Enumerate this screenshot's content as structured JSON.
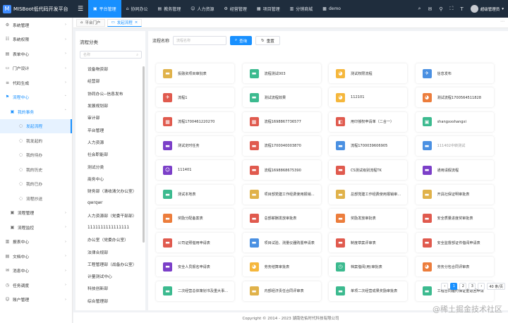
{
  "app": {
    "title": "MISBoot低代码开发平台",
    "logo_glyph": "M",
    "fold_icon": "menu-fold-icon",
    "accent": "#1890ff",
    "header_bg": "#1f2d3d"
  },
  "top_menu": [
    {
      "label": "平台管理",
      "icon": "▣",
      "active": true
    },
    {
      "label": "协同办公",
      "icon": "⌂"
    },
    {
      "label": "教务管理",
      "icon": "▤"
    },
    {
      "label": "人力资源",
      "icon": "☺"
    },
    {
      "label": "经营管理",
      "icon": "⚙"
    },
    {
      "label": "项目管理",
      "icon": "▦"
    },
    {
      "label": "分销商城",
      "icon": "▥"
    },
    {
      "label": "demo",
      "icon": "▩"
    }
  ],
  "top_right": {
    "icons": [
      "⌕",
      "✉",
      "⚲",
      "⛶",
      "T"
    ],
    "username": "超级管理员"
  },
  "sidebar": [
    {
      "label": "系统管理",
      "icon": "⚙",
      "level": 1,
      "chev": "›"
    },
    {
      "label": "系统权限",
      "icon": "☷",
      "level": 1,
      "chev": "›"
    },
    {
      "label": "表单中心",
      "icon": "▤",
      "level": 1,
      "chev": "›"
    },
    {
      "label": "门户设计",
      "icon": "▭",
      "level": 1,
      "chev": "›"
    },
    {
      "label": "代码生成",
      "icon": "≡",
      "level": 1,
      "chev": "›"
    },
    {
      "label": "流程中心",
      "icon": "⚑",
      "level": 1,
      "chev": "˄",
      "state": "blue"
    },
    {
      "label": "我的事务",
      "icon": "▣",
      "level": 2,
      "chev": "˄",
      "state": "blue"
    },
    {
      "label": "发起流程",
      "icon": "◌",
      "level": 3,
      "state": "sel"
    },
    {
      "label": "我发起的",
      "icon": "◌",
      "level": 3
    },
    {
      "label": "我的待办",
      "icon": "◌",
      "level": 3
    },
    {
      "label": "我的历史",
      "icon": "◌",
      "level": 3
    },
    {
      "label": "我的已办",
      "icon": "◌",
      "level": 3
    },
    {
      "label": "流程抄送",
      "icon": "◌",
      "level": 3
    },
    {
      "label": "流程管理",
      "icon": "▣",
      "level": 2,
      "chev": "›"
    },
    {
      "label": "流程监控",
      "icon": "▣",
      "level": 2,
      "chev": "›"
    },
    {
      "label": "报表中心",
      "icon": "▥",
      "level": 1,
      "chev": "›"
    },
    {
      "label": "文档中心",
      "icon": "▤",
      "level": 1,
      "chev": "›"
    },
    {
      "label": "消息中心",
      "icon": "✉",
      "level": 1,
      "chev": "›"
    },
    {
      "label": "任务调度",
      "icon": "◷",
      "level": 1,
      "chev": "›"
    },
    {
      "label": "账户管理",
      "icon": "☺",
      "level": 1,
      "chev": "›"
    }
  ],
  "tabs": [
    {
      "label": "平台门户",
      "icon": "⌂",
      "active": false
    },
    {
      "label": "发起流程",
      "icon": "▭",
      "active": true,
      "close": "×"
    }
  ],
  "tabs_right": "⋯",
  "category": {
    "title": "流程分类",
    "search_placeholder": "名称",
    "search_icon": "⌕",
    "items": [
      "设备物资部",
      "经营部",
      "协同办公--信息发布",
      "发展规划部",
      "审计部",
      "平台管理",
      "人力资源",
      "社会职能部",
      "测试分类",
      "商务中心",
      "财务部（清收清欠办公室）",
      "qwrqwr",
      "人力资源部（党委干部部）",
      "1111111111111111",
      "办公室（党委办公室）",
      "法律合规部",
      "工程管理部（战备办公室）",
      "计量测试中心",
      "科技创新部",
      "综合管理部"
    ]
  },
  "filter": {
    "label": "流程名称",
    "placeholder": "流程名称",
    "search_btn": "查询",
    "search_icon": "⌕",
    "reset_btn": "重置",
    "reset_icon": "↻"
  },
  "processes": [
    {
      "name": "投融资项目审批表",
      "color": "#e0b24a",
      "icon": "▬"
    },
    {
      "name": "流程测试003",
      "color": "#3cba8f",
      "icon": "▬"
    },
    {
      "name": "测试权限流程",
      "color": "#f5b73c",
      "icon": "◕"
    },
    {
      "name": "信息发布",
      "color": "#4a90e2",
      "icon": "✈"
    },
    {
      "name": "流程1",
      "color": "#e05a4e",
      "icon": "✈"
    },
    {
      "name": "测试流程效果",
      "color": "#3cba8f",
      "icon": "▬"
    },
    {
      "name": "112101",
      "color": "#f5b73c",
      "icon": "◕"
    },
    {
      "name": "测试流程1700564511828",
      "color": "#ec7d3c",
      "icon": "◕"
    },
    {
      "name": "流程1700461220270",
      "color": "#e05a4e",
      "icon": "▦"
    },
    {
      "name": "流程1698867736577",
      "color": "#e05a4e",
      "icon": "▦"
    },
    {
      "name": "用印授权申请单（二合一）",
      "color": "#e05a4e",
      "icon": "◧"
    },
    {
      "name": "shangxxshangxi",
      "color": "#3cba8f",
      "icon": "▣"
    },
    {
      "name": "测试定时任务",
      "color": "#7b3fc8",
      "icon": "▬"
    },
    {
      "name": "流程1700040003870",
      "color": "#e05a4e",
      "icon": "▬"
    },
    {
      "name": "流程1700039606905",
      "color": "#4a90e2",
      "icon": "▬"
    },
    {
      "name": "111402中转测试",
      "color": "#4a90e2",
      "icon": "▬",
      "gray": true
    },
    {
      "name": "111401",
      "color": "#7b3fc8",
      "icon": "☺"
    },
    {
      "name": "流程1698868675390",
      "color": "#e05a4e",
      "icon": "▬"
    },
    {
      "name": "CS测试级别流程TK",
      "color": "#e05a4e",
      "icon": "▬"
    },
    {
      "name": "通用请假流程",
      "color": "#7b3fc8",
      "icon": "▬"
    },
    {
      "name": "测试本地表",
      "color": "#3cba8f",
      "icon": "▬"
    },
    {
      "name": "项目部党建工作经费使用报销...",
      "color": "#e0b24a",
      "icon": "▬"
    },
    {
      "name": "总部党建工作经费使用报销审...",
      "color": "#e0b24a",
      "icon": "▬"
    },
    {
      "name": "开具社保证明审批表",
      "color": "#e0b24a",
      "icon": "▬"
    },
    {
      "name": "奖励分配备案表",
      "color": "#ec7d3c",
      "icon": "▬"
    },
    {
      "name": "总部薪酬发放审批表",
      "color": "#e05a4e",
      "icon": "▬"
    },
    {
      "name": "奖励发放审批表",
      "color": "#ec7d3c",
      "icon": "▬"
    },
    {
      "name": "安全质量进度奖审批表",
      "color": "#e05a4e",
      "icon": "▬"
    },
    {
      "name": "公司证照借用申请表",
      "color": "#e05a4e",
      "icon": "▬"
    },
    {
      "name": "项目试验、测量仪器购置申请表",
      "color": "#4a90e2",
      "icon": "▬"
    },
    {
      "name": "制度草案评审表",
      "color": "#e05a4e",
      "icon": "▬"
    },
    {
      "name": "安全监督部证件借阅申请表",
      "color": "#e05a4e",
      "icon": "▬"
    },
    {
      "name": "安全人员报名申请表",
      "color": "#7b3fc8",
      "icon": "▬"
    },
    {
      "name": "劳务结算审批表",
      "color": "#f5b73c",
      "icon": "◕"
    },
    {
      "name": "档案借阅(用)审批表",
      "color": "#3cba8f",
      "icon": "◷"
    },
    {
      "name": "劳务分包合同评审表",
      "color": "#ec7d3c",
      "icon": "◕"
    },
    {
      "name": "二次经营总体策划书及重大事...",
      "color": "#3cba8f",
      "icon": "▬"
    },
    {
      "name": "内部经济责任合同评审表",
      "color": "#e0b24a",
      "icon": "▬"
    },
    {
      "name": "单项二次经营成果奖励审批表",
      "color": "#3cba8f",
      "icon": "▬"
    },
    {
      "name": "工程合同履约保证金退回申请",
      "color": "#3cba8f",
      "icon": "▬"
    }
  ],
  "pager": {
    "prev": "‹",
    "pages": [
      "1",
      "2",
      "3"
    ],
    "next": "›",
    "size": "40 条/页"
  },
  "footer": "Copyright © 2014 - 2023 湖南佐佑时代科技有限公司",
  "watermark": "@稀土掘金技术社区"
}
